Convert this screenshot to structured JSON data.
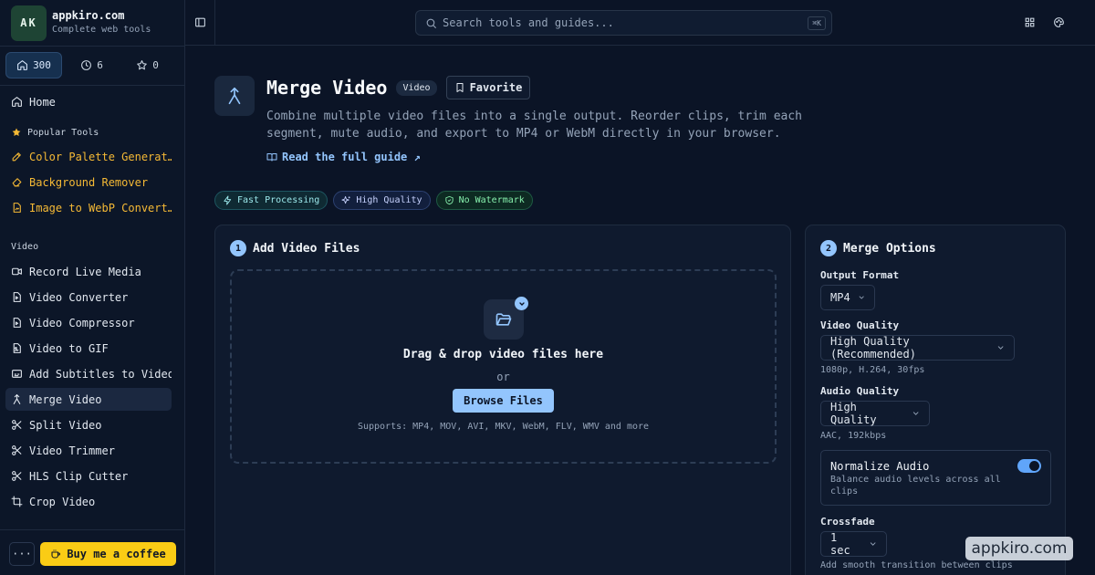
{
  "brand": {
    "initials": "AK",
    "name": "appkiro.com",
    "tagline": "Complete web tools"
  },
  "stats": {
    "all": "300",
    "recent": "6",
    "favorites": "0"
  },
  "nav": {
    "home": "Home",
    "popular_section": "Popular Tools",
    "popular": [
      "Color Palette Generat…",
      "Background Remover",
      "Image to WebP Convert…"
    ],
    "video_section": "Video",
    "video": [
      "Record Live Media",
      "Video Converter",
      "Video Compressor",
      "Video to GIF",
      "Add Subtitles to Video",
      "Merge Video",
      "Split Video",
      "Video Trimmer",
      "HLS Clip Cutter",
      "Crop Video"
    ]
  },
  "footer": {
    "more": "···",
    "coffee": "Buy me a coffee"
  },
  "search": {
    "placeholder": "Search tools and guides...",
    "shortcut": "⌘K"
  },
  "tool": {
    "title": "Merge Video",
    "category": "Video",
    "favorite_label": "Favorite",
    "description": "Combine multiple video files into a single output. Reorder clips, trim each segment, mute audio, and export to MP4 or WebM directly in your browser.",
    "guide_link": "Read the full guide ↗",
    "features": [
      "Fast Processing",
      "High Quality",
      "No Watermark"
    ]
  },
  "files_card": {
    "step": "1",
    "title": "Add Video Files",
    "drop_title": "Drag & drop video files here",
    "or": "or",
    "browse": "Browse Files",
    "supports": "Supports: MP4, MOV, AVI, MKV, WebM, FLV, WMV and more"
  },
  "options_card": {
    "step": "2",
    "title": "Merge Options",
    "output_format_label": "Output Format",
    "output_format": "MP4",
    "video_quality_label": "Video Quality",
    "video_quality": "High Quality (Recommended)",
    "video_quality_hint": "1080p, H.264, 30fps",
    "audio_quality_label": "Audio Quality",
    "audio_quality": "High Quality",
    "audio_quality_hint": "AAC, 192kbps",
    "normalize_title": "Normalize Audio",
    "normalize_desc": "Balance audio levels across all clips",
    "normalize_on": true,
    "crossfade_label": "Crossfade",
    "crossfade": "1 sec",
    "crossfade_hint": "Add smooth transition between clips"
  },
  "watermark": "appkiro.com",
  "colors": {
    "accent": "#93c5fd",
    "background": "#0b1426",
    "popular": "#f5b935",
    "coffee": "#facc15"
  }
}
